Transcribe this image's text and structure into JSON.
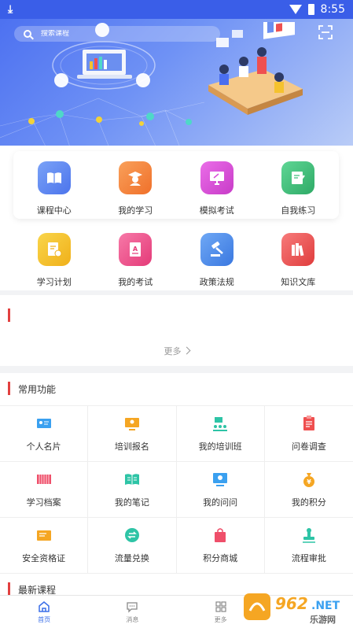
{
  "status_bar": {
    "time": "8:55"
  },
  "search": {
    "placeholder": "搜索课程"
  },
  "top_grid": [
    {
      "label": "课程中心",
      "icon": "book-icon",
      "color": "#5b86f0"
    },
    {
      "label": "我的学习",
      "icon": "graduate-icon",
      "color": "#f5823a"
    },
    {
      "label": "模拟考试",
      "icon": "monitor-icon",
      "color": "#d94fd8"
    },
    {
      "label": "自我练习",
      "icon": "edit-icon",
      "color": "#3fbf7a"
    }
  ],
  "second_grid": [
    {
      "label": "学习计划",
      "icon": "plan-icon",
      "color": "#f5c22e"
    },
    {
      "label": "我的考试",
      "icon": "exam-icon",
      "color": "#ef4f8a"
    },
    {
      "label": "政策法规",
      "icon": "gavel-icon",
      "color": "#4a8ff0"
    },
    {
      "label": "知识文库",
      "icon": "library-icon",
      "color": "#ef5050"
    }
  ],
  "news": {
    "more_label": "更多"
  },
  "common": {
    "title": "常用功能",
    "items": [
      {
        "label": "个人名片",
        "icon": "card-icon",
        "color": "#3aa0f0"
      },
      {
        "label": "培训报名",
        "icon": "signup-icon",
        "color": "#f5a623"
      },
      {
        "label": "我的培训班",
        "icon": "class-icon",
        "color": "#2ec4a6"
      },
      {
        "label": "问卷调查",
        "icon": "survey-icon",
        "color": "#ef4f4f"
      },
      {
        "label": "学习档案",
        "icon": "archive-icon",
        "color": "#ef4f6a"
      },
      {
        "label": "我的笔记",
        "icon": "notes-icon",
        "color": "#2ec4a6"
      },
      {
        "label": "我的问问",
        "icon": "question-icon",
        "color": "#3aa0f0"
      },
      {
        "label": "我的积分",
        "icon": "points-icon",
        "color": "#f5a623"
      },
      {
        "label": "安全资格证",
        "icon": "certificate-icon",
        "color": "#f5a623"
      },
      {
        "label": "流量兑换",
        "icon": "exchange-icon",
        "color": "#2ec4a6"
      },
      {
        "label": "积分商城",
        "icon": "shop-icon",
        "color": "#ef4f6a"
      },
      {
        "label": "流程审批",
        "icon": "stamp-icon",
        "color": "#2ec4a6"
      }
    ]
  },
  "latest": {
    "title": "最新课程"
  },
  "tabbar": [
    {
      "label": "首页",
      "icon": "home-icon",
      "active": true
    },
    {
      "label": "消息",
      "icon": "message-icon",
      "active": false
    },
    {
      "label": "更多",
      "icon": "grid-icon",
      "active": false
    }
  ],
  "watermark": {
    "brand": "962.NET",
    "sub": "乐游网"
  }
}
